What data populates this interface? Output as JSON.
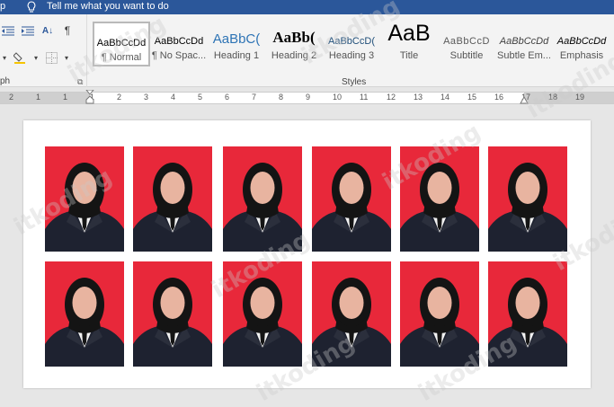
{
  "titlebar": {
    "left_fragment": "p",
    "tell_me": "Tell me what you want to do",
    "bg_color": "#2b579a"
  },
  "paragraph_group": {
    "label": "ph",
    "row1": [
      "indent-decrease-icon",
      "indent-increase-icon",
      "sort-icon",
      "pilcrow-icon"
    ],
    "row2": [
      "chevron-down-icon",
      "shading-icon",
      "borders-icon"
    ]
  },
  "styles": {
    "group_label": "Styles",
    "items": [
      {
        "preview": "AaBbCcDd",
        "name": "¶ Normal",
        "selected": true
      },
      {
        "preview": "AaBbCcDd",
        "name": "¶ No Spac...",
        "selected": false
      },
      {
        "preview": "AaBbC(",
        "name": "Heading 1",
        "selected": false
      },
      {
        "preview": "AaBb(",
        "name": "Heading 2",
        "selected": false
      },
      {
        "preview": "AaBbCcD(",
        "name": "Heading 3",
        "selected": false
      },
      {
        "preview": "AaB",
        "name": "Title",
        "selected": false
      },
      {
        "preview": "AaBbCcD",
        "name": "Subtitle",
        "selected": false
      },
      {
        "preview": "AaBbCcDd",
        "name": "Subtle Em...",
        "selected": false
      },
      {
        "preview": "AaBbCcDd",
        "name": "Emphasis",
        "selected": false
      }
    ]
  },
  "ruler": {
    "numbers": [
      "2",
      "1",
      "1",
      "1",
      "2",
      "3",
      "4",
      "5",
      "6",
      "7",
      "8",
      "9",
      "10",
      "11",
      "12",
      "13",
      "14",
      "15",
      "16",
      "17",
      "18",
      "19"
    ]
  },
  "document": {
    "photo_count": 12,
    "photo_bg_color": "#e8283a",
    "watermark_text": "itkoding"
  }
}
